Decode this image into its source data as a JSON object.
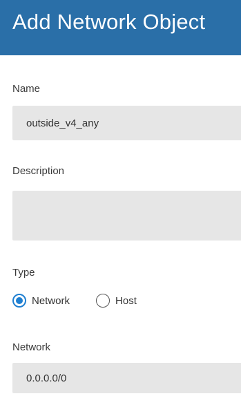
{
  "dialog": {
    "title": "Add Network Object"
  },
  "form": {
    "name": {
      "label": "Name",
      "value": "outside_v4_any"
    },
    "description": {
      "label": "Description",
      "value": ""
    },
    "type": {
      "label": "Type",
      "options": [
        {
          "label": "Network",
          "selected": true
        },
        {
          "label": "Host",
          "selected": false
        }
      ]
    },
    "network": {
      "label": "Network",
      "value": "0.0.0.0/0"
    }
  },
  "colors": {
    "header": "#2a6fa8",
    "accent": "#1f7fd1",
    "field_bg": "#e6e6e6"
  }
}
